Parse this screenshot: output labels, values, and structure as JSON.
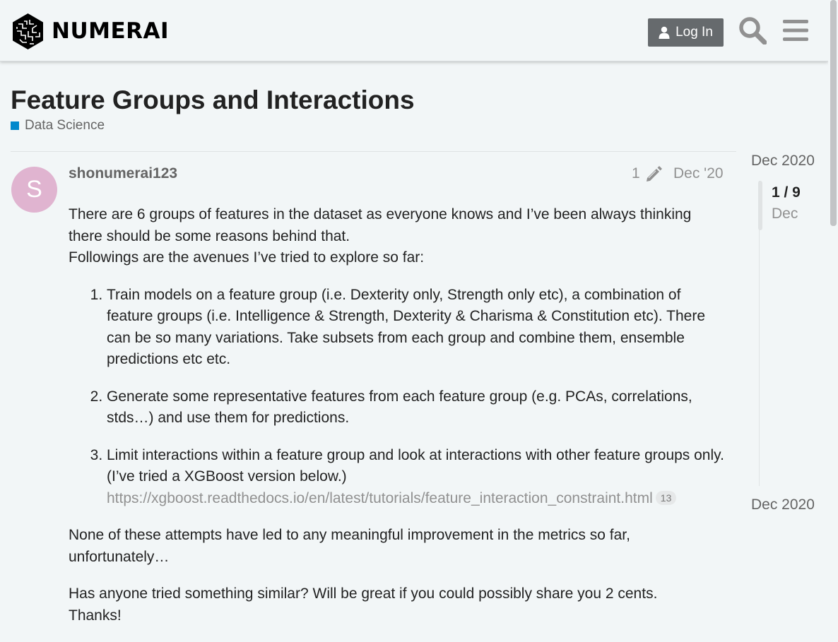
{
  "header": {
    "logo_text": "NUMERAI",
    "login_label": "Log In"
  },
  "topic": {
    "title": "Feature Groups and Interactions",
    "category": "Data Science",
    "category_color": "#0088cc"
  },
  "post": {
    "avatar_letter": "S",
    "avatar_color": "#e0b4d0",
    "username": "shonumerai123",
    "edit_count": "1",
    "date": "Dec '20",
    "intro_1": "There are 6 groups of features in the dataset as everyone knows and I’ve been always thinking there should be some reasons behind that.",
    "intro_2": "Followings are the avenues I’ve tried to explore so far:",
    "list": [
      "Train models on a feature group (i.e. Dexterity only, Strength only etc), a combination of feature groups (i.e. Intelligence & Strength, Dexterity & Charisma & Constitution etc). There can be so many variations. Take subsets from each group and combine them, ensemble predictions etc etc.",
      "Generate some representative features from each feature group (e.g. PCAs, correlations, stds…) and use them for predictions.",
      "Limit interactions within a feature group and look at interactions with other feature groups only. (I’ve tried a XGBoost version below.)"
    ],
    "link_url": "https://xgboost.readthedocs.io/en/latest/tutorials/feature_interaction_constraint.html",
    "link_clicks": "13",
    "outro_1": "None of these attempts have led to any meaningful improvement in the metrics so far, unfortunately…",
    "outro_2a": "Has anyone tried something similar? Will be great if you could possibly share you 2 cents.",
    "outro_2b": "Thanks!"
  },
  "timeline": {
    "start": "Dec 2020",
    "position": "1 / 9",
    "current_month": "Dec",
    "end": "Dec 2020"
  }
}
